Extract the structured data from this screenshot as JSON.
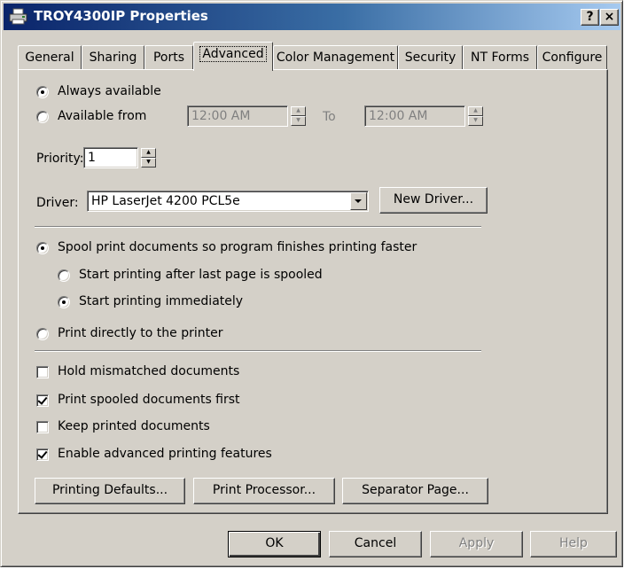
{
  "window": {
    "title": "TROY4300IP Properties",
    "help_btn": "?",
    "close_btn": "×"
  },
  "tabs": [
    {
      "label": "General"
    },
    {
      "label": "Sharing"
    },
    {
      "label": "Ports"
    },
    {
      "label": "Advanced",
      "active": true
    },
    {
      "label": "Color Management"
    },
    {
      "label": "Security"
    },
    {
      "label": "NT Forms"
    },
    {
      "label": "Configure"
    }
  ],
  "availability": {
    "always_label": "Always available",
    "always_selected": true,
    "from_label": "Available from",
    "from_time": "12:00 AM",
    "to_label": "To",
    "to_time": "12:00 AM"
  },
  "priority": {
    "label": "Priority:",
    "value": "1"
  },
  "driver": {
    "label": "Driver:",
    "value": "HP LaserJet 4200 PCL5e",
    "new_driver_label": "New Driver..."
  },
  "spooling": {
    "spool_label": "Spool print documents so program finishes printing faster",
    "spool_selected": true,
    "after_last_label": "Start printing after last page is spooled",
    "after_last_selected": false,
    "immediately_label": "Start printing immediately",
    "immediately_selected": true,
    "direct_label": "Print directly to the printer",
    "direct_selected": false
  },
  "options": [
    {
      "label": "Hold mismatched documents",
      "checked": false
    },
    {
      "label": "Print spooled documents first",
      "checked": true
    },
    {
      "label": "Keep printed documents",
      "checked": false
    },
    {
      "label": "Enable advanced printing features",
      "checked": true
    }
  ],
  "panel_buttons": {
    "defaults": "Printing Defaults...",
    "processor": "Print Processor...",
    "separator": "Separator Page..."
  },
  "dialog_buttons": {
    "ok": "OK",
    "cancel": "Cancel",
    "apply": "Apply",
    "help": "Help"
  },
  "colors": {
    "titlebar_start": "#0a246a",
    "titlebar_end": "#a6caf0",
    "face": "#d4d0c8"
  }
}
